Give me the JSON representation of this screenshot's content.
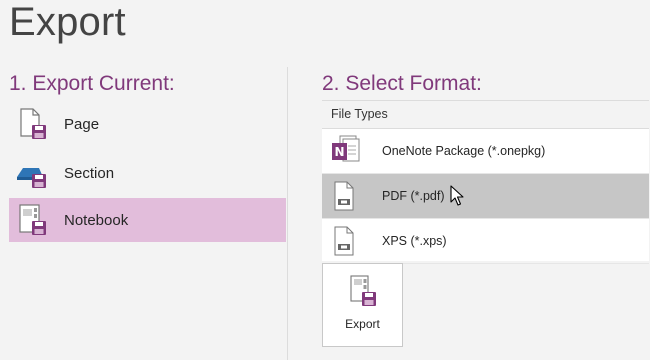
{
  "page": {
    "title": "Export"
  },
  "left": {
    "heading": "1. Export Current:",
    "items": [
      {
        "label": "Page",
        "icon": "page-icon",
        "selected": false
      },
      {
        "label": "Section",
        "icon": "section-icon",
        "selected": false
      },
      {
        "label": "Notebook",
        "icon": "notebook-icon",
        "selected": true
      }
    ]
  },
  "right": {
    "heading": "2. Select Format:",
    "header": "File Types",
    "formats": [
      {
        "label": "OneNote Package (*.onepkg)",
        "icon": "onenote-package-icon",
        "selected": false
      },
      {
        "label": "PDF (*.pdf)",
        "icon": "pdf-file-icon",
        "selected": true
      },
      {
        "label": "XPS (*.xps)",
        "icon": "xps-file-icon",
        "selected": false
      }
    ]
  },
  "export_button": {
    "label": "Export",
    "icon": "export-icon"
  },
  "colors": {
    "accent": "#80397b",
    "selected_scope": "#e2bddb",
    "selected_format": "#c6c6c6",
    "background": "#f3f3f3"
  }
}
